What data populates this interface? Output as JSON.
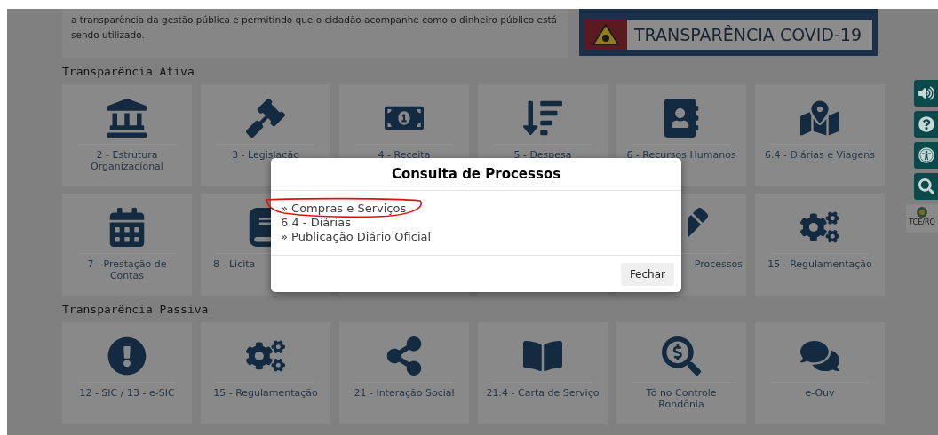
{
  "intro": {
    "text": "a transparência da gestão pública e permitindo que o cidadão acompanhe como o dinheiro público está sendo utilizado."
  },
  "banner": {
    "title": "TRANSPARÊNCIA COVID-19"
  },
  "sections": [
    {
      "title": "Transparência Ativa",
      "tiles": [
        {
          "kind": "landmark",
          "label": "2 - Estrutura Organizacional"
        },
        {
          "kind": "gavel",
          "label": "3 - Legislação"
        },
        {
          "kind": "money",
          "label": "4 - Receita"
        },
        {
          "kind": "sort",
          "label": "5 - Despesa"
        },
        {
          "kind": "contacts",
          "label": "6 - Recursos Humanos"
        },
        {
          "kind": "map",
          "label": "6.4 - Diárias e Viagens"
        },
        {
          "kind": "calendar",
          "label": "7 - Prestação de Contas"
        },
        {
          "kind": "book",
          "label": "8 - Licita",
          "cut_right": true
        },
        {
          "kind": "blank"
        },
        {
          "kind": "blank"
        },
        {
          "kind": "pen",
          "label": "Processos",
          "cut_left": true
        },
        {
          "kind": "cogs",
          "label": "15 - Regulamentação"
        }
      ]
    },
    {
      "title": "Transparência Passiva",
      "tiles": [
        {
          "kind": "alert",
          "label": "12 - SIC / 13 - e-SIC"
        },
        {
          "kind": "cogs",
          "label": "15 - Regulamentação"
        },
        {
          "kind": "share",
          "label": "21 - Interação Social"
        },
        {
          "kind": "openbook",
          "label": "21.4 - Carta de Serviço"
        },
        {
          "kind": "searchmoney",
          "label": "Tô no Controle Rondônia"
        },
        {
          "kind": "chat",
          "label": "e-Ouv"
        }
      ]
    }
  ],
  "side_toolbar": {
    "buttons": [
      {
        "kind": "audio"
      },
      {
        "kind": "help"
      },
      {
        "kind": "accessibility"
      },
      {
        "kind": "search"
      }
    ],
    "logo": "TCE/RO"
  },
  "modal": {
    "title": "Consulta de Processos",
    "links": [
      "» Compras e Serviços",
      "6.4 - Diárias",
      "» Publicação Diário Oficial"
    ],
    "close_button": "Fechar"
  }
}
